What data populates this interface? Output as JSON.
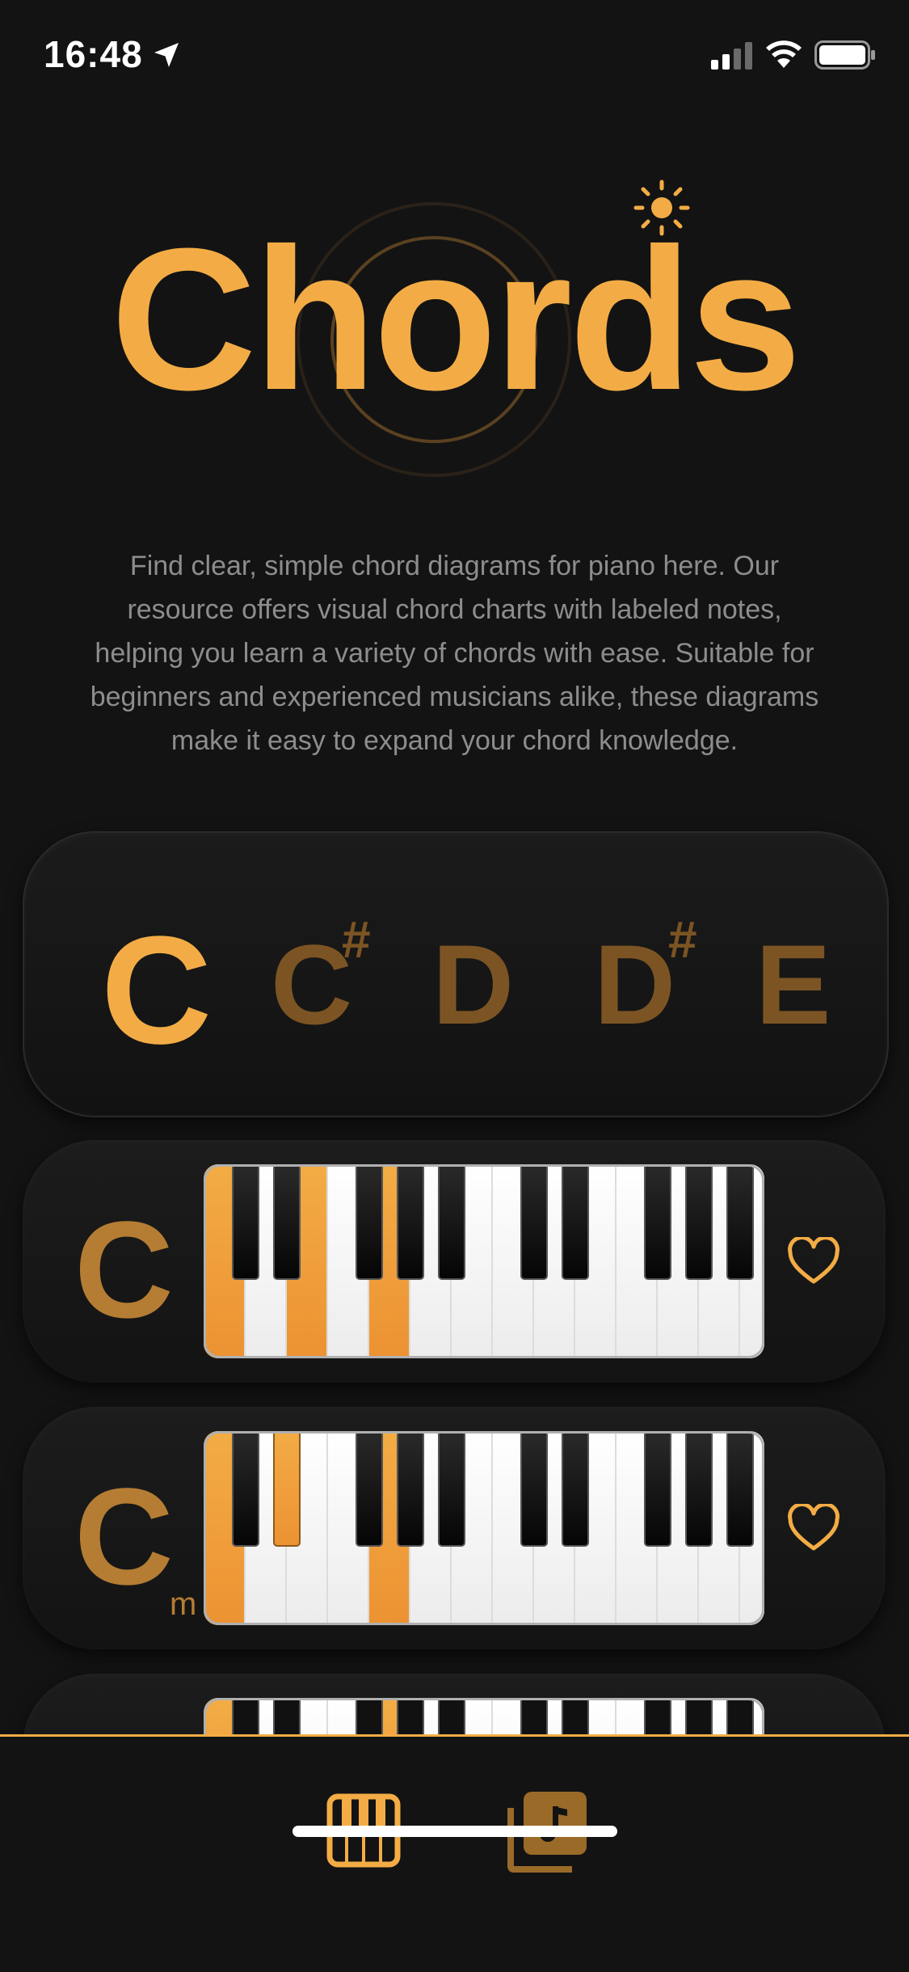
{
  "status_bar": {
    "time": "16:48"
  },
  "header": {
    "title": "Chords",
    "description": "Find clear, simple chord diagrams for piano here. Our resource offers visual chord charts with labeled notes, helping you learn a variety of chords with ease. Suitable for beginners and experienced musicians alike, these diagrams make it easy to expand your chord knowledge."
  },
  "notes": [
    {
      "root": "C",
      "sharp": "",
      "selected": true
    },
    {
      "root": "C",
      "sharp": "#",
      "selected": false
    },
    {
      "root": "D",
      "sharp": "",
      "selected": false
    },
    {
      "root": "D",
      "sharp": "#",
      "selected": false
    },
    {
      "root": "E",
      "sharp": "",
      "selected": false
    }
  ],
  "chords": [
    {
      "name": "C",
      "suffix": "",
      "favorite_icon": "heart-outline-icon"
    },
    {
      "name": "C",
      "suffix": "m",
      "favorite_icon": "heart-outline-icon"
    }
  ],
  "tabs": [
    {
      "icon": "piano-keys-icon",
      "active": true
    },
    {
      "icon": "music-library-icon",
      "active": false
    }
  ],
  "colors": {
    "accent": "#f3ac45",
    "accent_dim": "#7c5423",
    "chord_label": "#b57d33",
    "background": "#131313"
  }
}
